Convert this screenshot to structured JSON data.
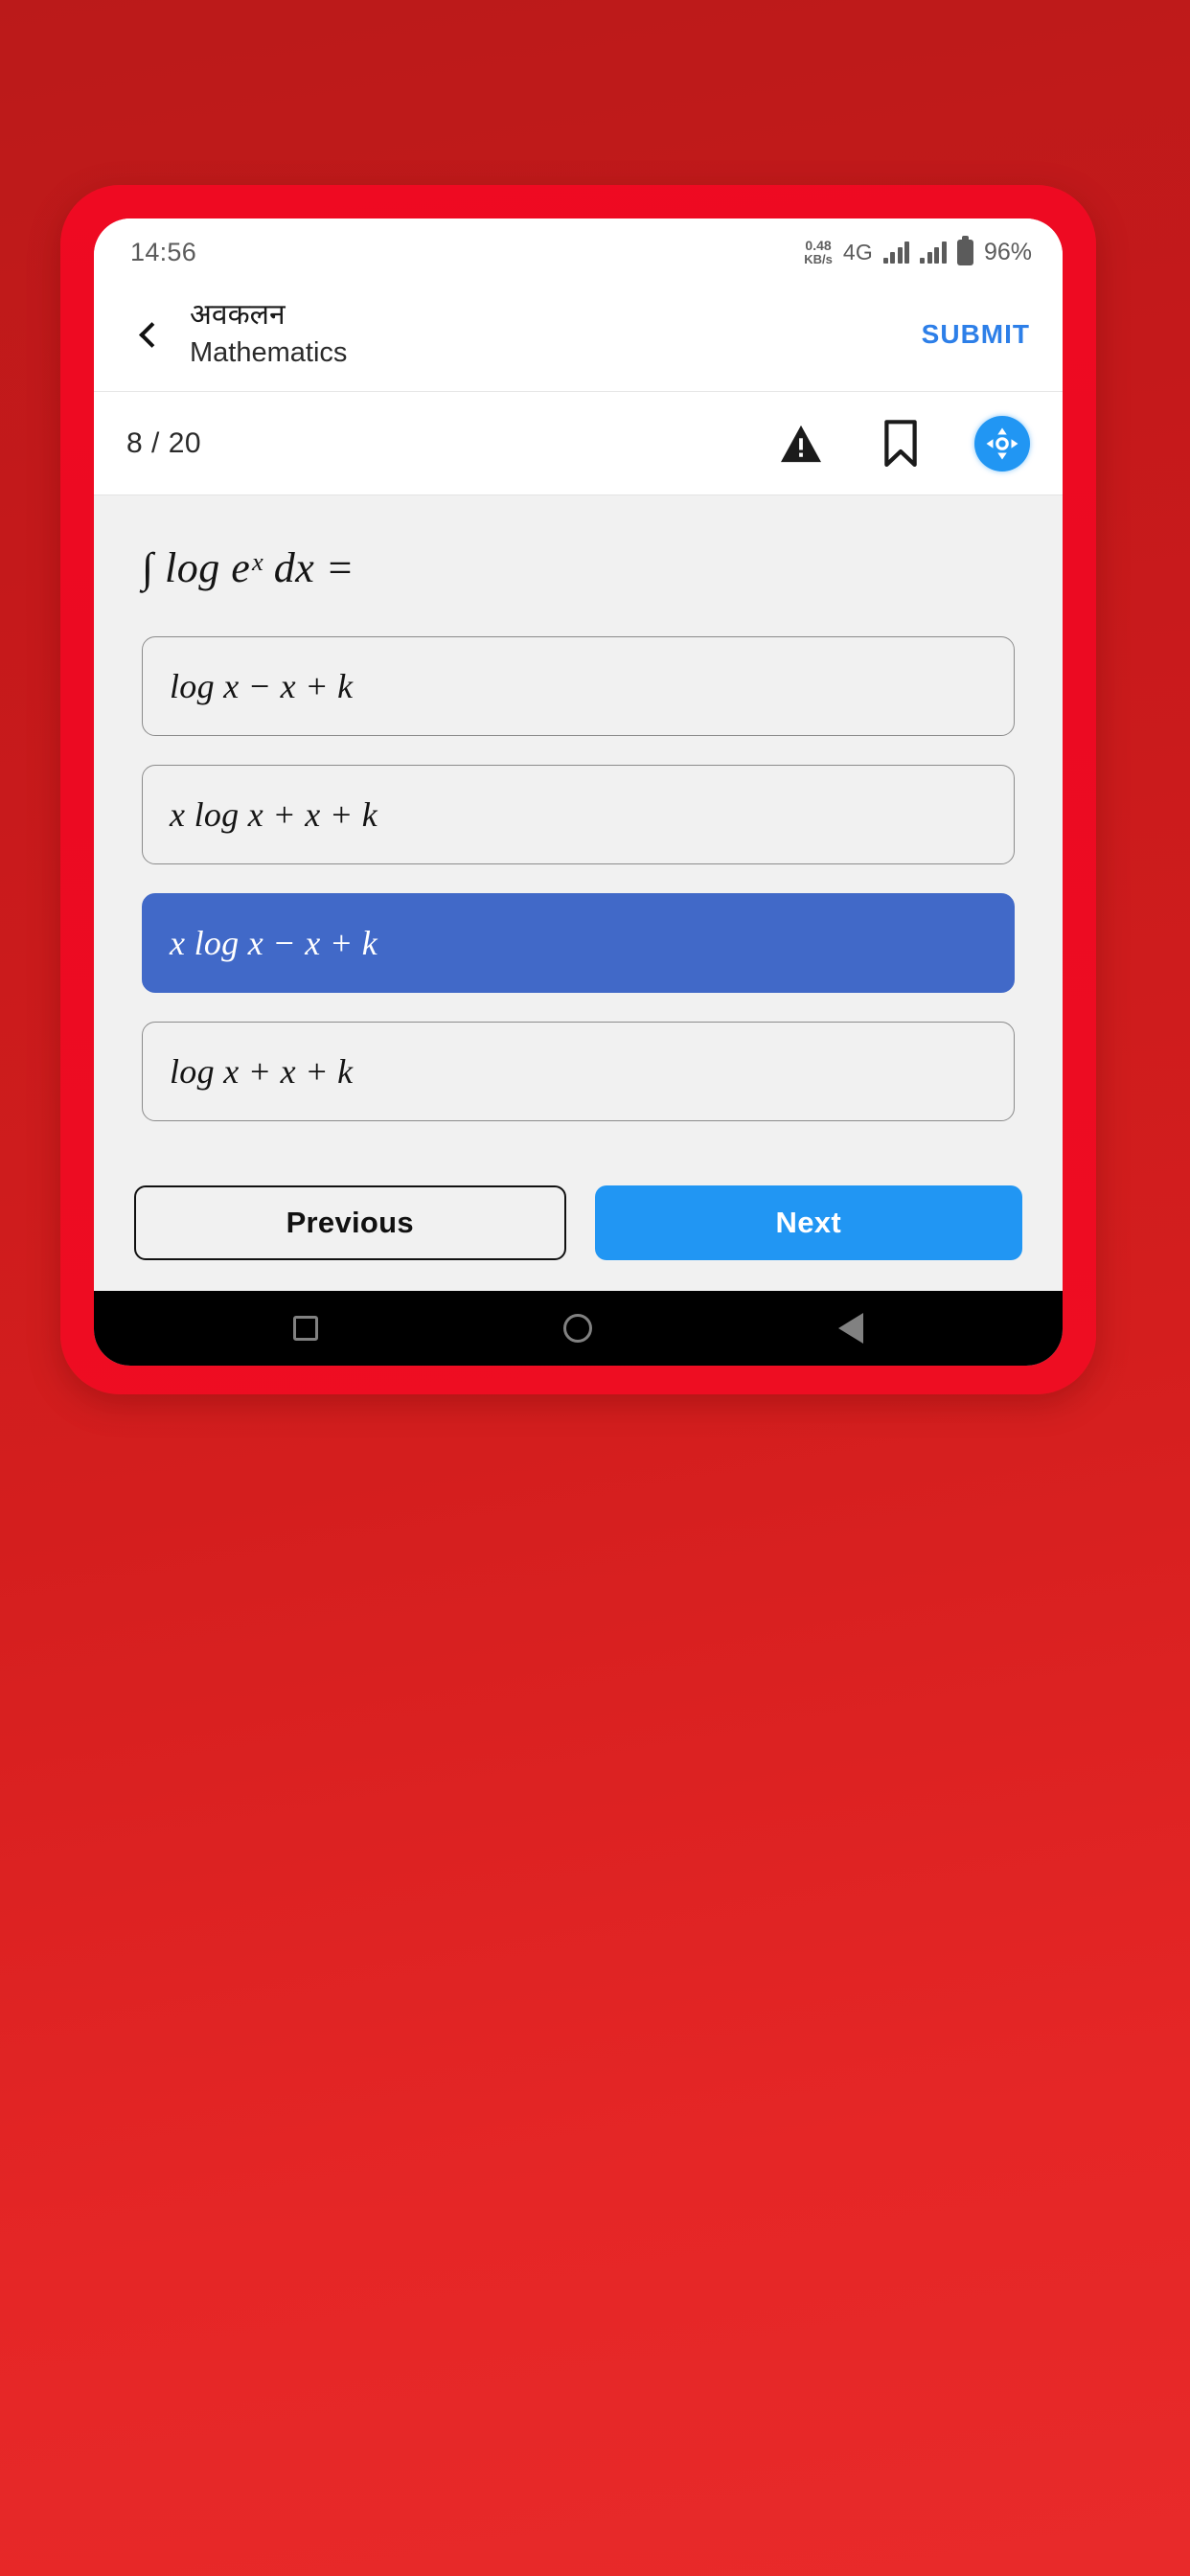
{
  "background": {
    "top_color": "#bb1a1a",
    "bottom_color": "#e82a2a"
  },
  "phone_frame": {
    "color": "#ee0a22"
  },
  "status_bar": {
    "time": "14:56",
    "net_speed_value": "0.48",
    "net_speed_unit": "KB/s",
    "network_type": "4G",
    "signal_icon_1": "signal-bars-icon",
    "signal_icon_2": "signal-bars-icon",
    "battery_icon": "battery-full-icon",
    "battery_percent": "96%"
  },
  "header": {
    "back_icon": "chevron-left-icon",
    "title": "अवकलन",
    "subtitle": "Mathematics",
    "submit_label": "SUBMIT",
    "submit_color": "#2d7fe8"
  },
  "counter_bar": {
    "counter": "8 / 20",
    "report_icon": "warning-triangle-icon",
    "bookmark_icon": "bookmark-icon",
    "move_icon": "move-handle-icon",
    "move_color": "#2196f3"
  },
  "question": {
    "number": 8,
    "total": 20,
    "text": "∫ log eˣ dx =",
    "text_plain": "∫ log e^x dx =",
    "options": [
      {
        "id": "A",
        "text": "log x − x + k",
        "selected": false
      },
      {
        "id": "B",
        "text": "x log x + x + k",
        "selected": false
      },
      {
        "id": "C",
        "text": "x log x − x + k",
        "selected": true
      },
      {
        "id": "D",
        "text": "log x + x + k",
        "selected": false
      }
    ],
    "selected_option_id": "C",
    "selected_color": "#4169c8"
  },
  "bottom_bar": {
    "previous_label": "Previous",
    "next_label": "Next",
    "next_color": "#2196f3"
  },
  "android_nav": {
    "recents_icon": "square-icon",
    "home_icon": "circle-icon",
    "back_icon": "triangle-back-icon"
  }
}
